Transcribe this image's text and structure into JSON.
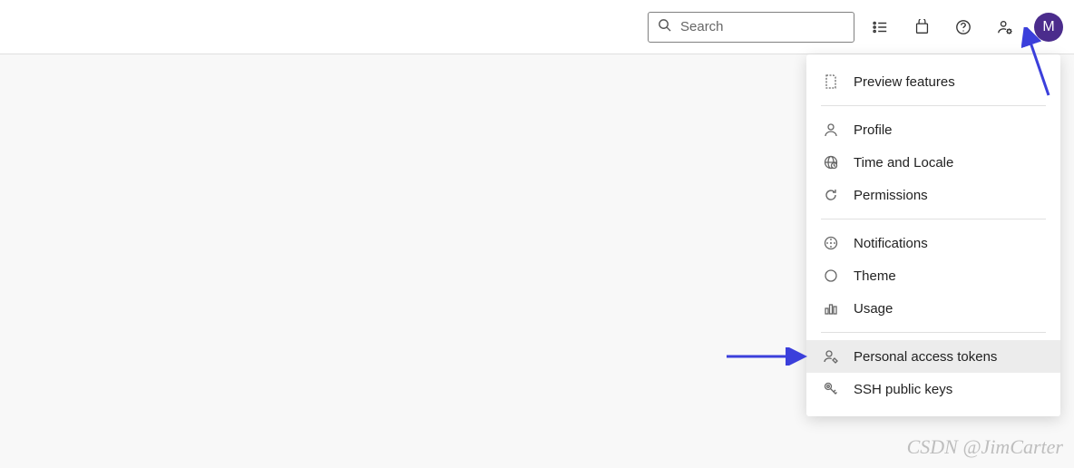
{
  "header": {
    "search_placeholder": "Search",
    "avatar_letter": "M"
  },
  "dropdown": {
    "sections": [
      {
        "items": [
          {
            "icon": "preview-icon",
            "label": "Preview features",
            "highlighted": false,
            "name": "menu-preview-features"
          }
        ]
      },
      {
        "items": [
          {
            "icon": "profile-icon",
            "label": "Profile",
            "highlighted": false,
            "name": "menu-profile"
          },
          {
            "icon": "locale-icon",
            "label": "Time and Locale",
            "highlighted": false,
            "name": "menu-time-locale"
          },
          {
            "icon": "refresh-icon",
            "label": "Permissions",
            "highlighted": false,
            "name": "menu-permissions"
          }
        ]
      },
      {
        "items": [
          {
            "icon": "notification-icon",
            "label": "Notifications",
            "highlighted": false,
            "name": "menu-notifications"
          },
          {
            "icon": "theme-icon",
            "label": "Theme",
            "highlighted": false,
            "name": "menu-theme"
          },
          {
            "icon": "usage-icon",
            "label": "Usage",
            "highlighted": false,
            "name": "menu-usage"
          }
        ]
      },
      {
        "items": [
          {
            "icon": "pat-icon",
            "label": "Personal access tokens",
            "highlighted": true,
            "name": "menu-personal-access-tokens"
          },
          {
            "icon": "ssh-icon",
            "label": "SSH public keys",
            "highlighted": false,
            "name": "menu-ssh-keys"
          }
        ]
      }
    ]
  },
  "annotations": {
    "arrow_color": "#3b3fdb",
    "watermark": "CSDN @JimCarter"
  }
}
